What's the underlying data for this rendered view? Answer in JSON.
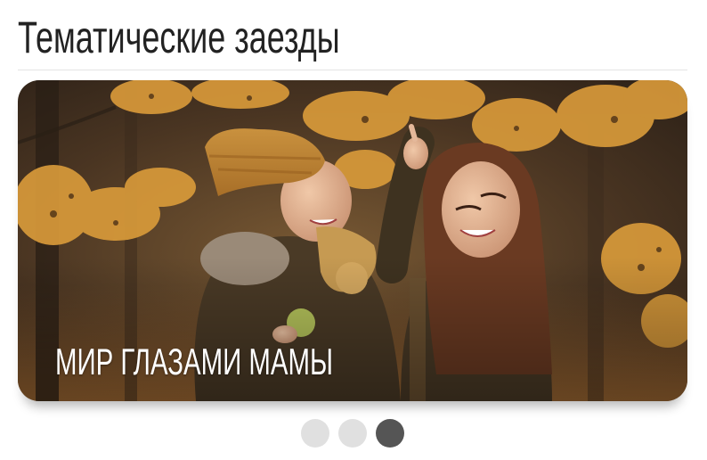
{
  "section": {
    "title": "Тематические заезды"
  },
  "slider": {
    "slides": [
      {
        "caption": "МИР ГЛАЗАМИ МАМЫ",
        "image": "autumn-mother-and-child-photo"
      }
    ],
    "dots": [
      {
        "label": "slide-1",
        "active": false
      },
      {
        "label": "slide-2",
        "active": false
      },
      {
        "label": "slide-3",
        "active": true
      }
    ]
  },
  "colors": {
    "title_text": "#222222",
    "divider": "#e4e4e4",
    "dot_inactive": "#e0e0e0",
    "dot_active": "#555555",
    "caption_text": "#ffffff"
  }
}
